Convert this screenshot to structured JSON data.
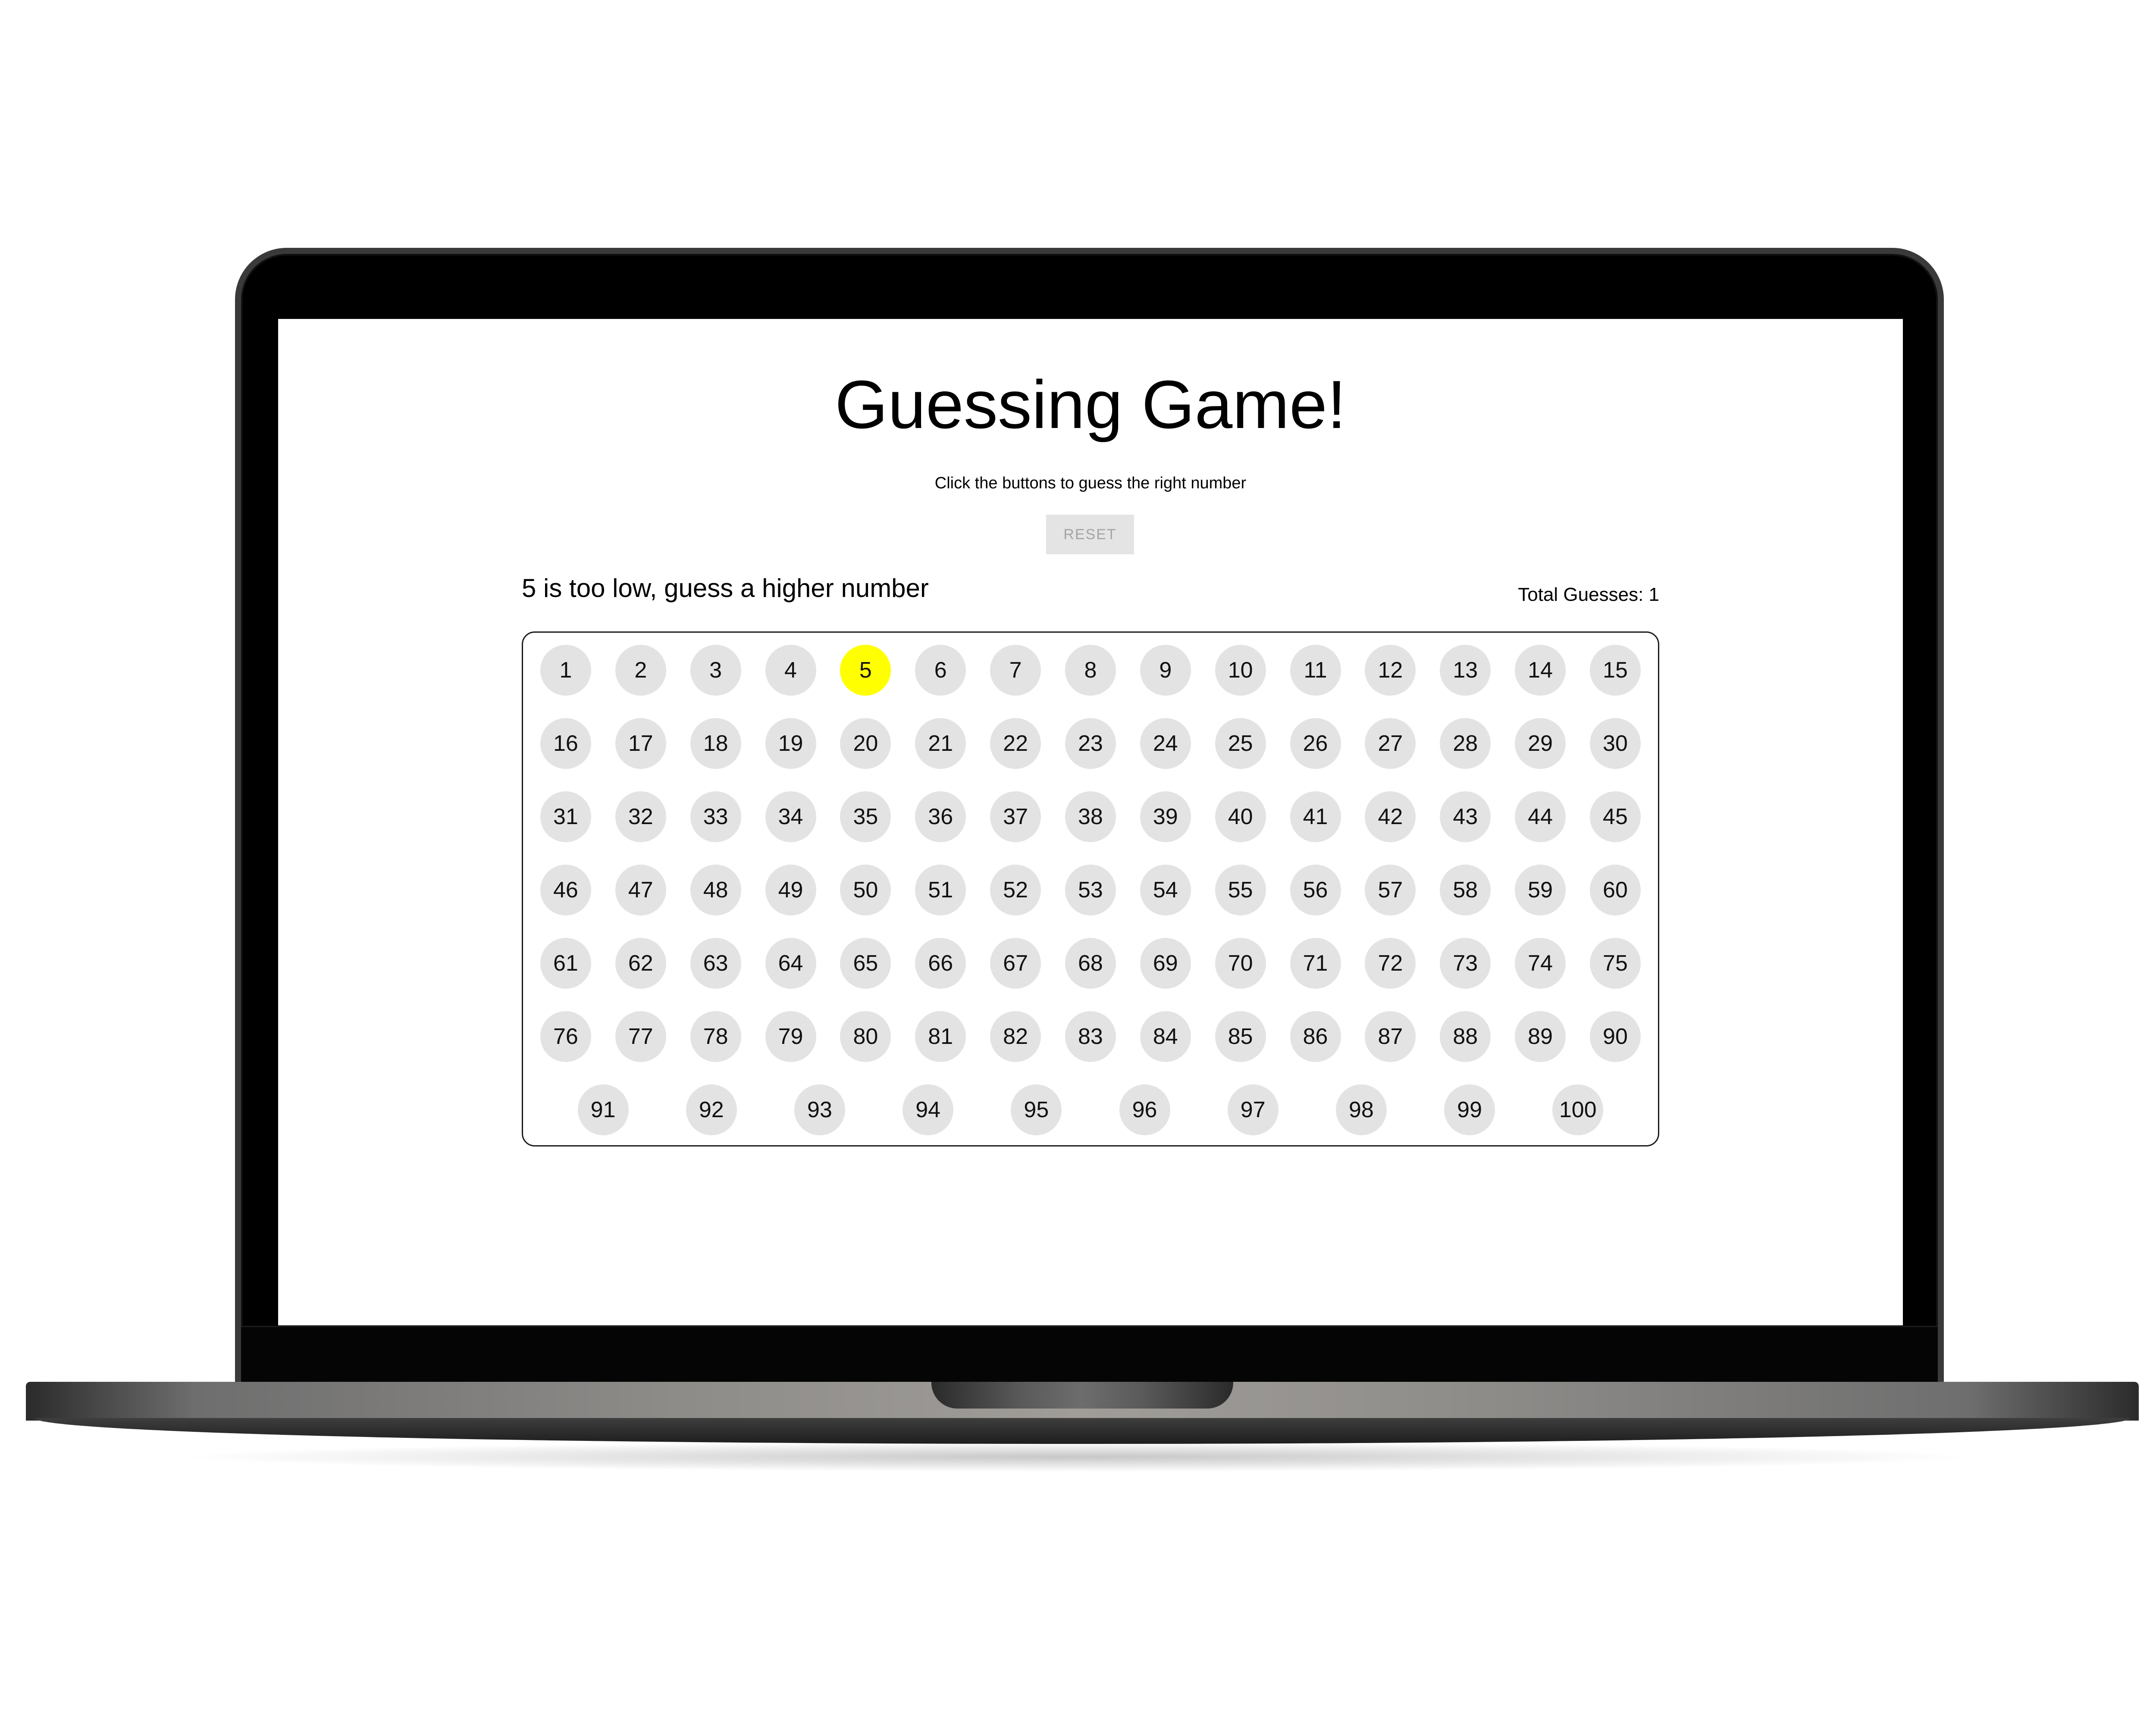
{
  "app": {
    "title": "Guessing Game!",
    "subtitle": "Click the buttons to guess the right number",
    "reset_label": "RESET",
    "message": "5 is too low, guess a higher number",
    "total_guesses_label": "Total Guesses: 1",
    "selected_number": 5,
    "highlight_color": "#ffff00",
    "button_color": "#e3e3e3",
    "numbers": [
      1,
      2,
      3,
      4,
      5,
      6,
      7,
      8,
      9,
      10,
      11,
      12,
      13,
      14,
      15,
      16,
      17,
      18,
      19,
      20,
      21,
      22,
      23,
      24,
      25,
      26,
      27,
      28,
      29,
      30,
      31,
      32,
      33,
      34,
      35,
      36,
      37,
      38,
      39,
      40,
      41,
      42,
      43,
      44,
      45,
      46,
      47,
      48,
      49,
      50,
      51,
      52,
      53,
      54,
      55,
      56,
      57,
      58,
      59,
      60,
      61,
      62,
      63,
      64,
      65,
      66,
      67,
      68,
      69,
      70,
      71,
      72,
      73,
      74,
      75,
      76,
      77,
      78,
      79,
      80,
      81,
      82,
      83,
      84,
      85,
      86,
      87,
      88,
      89,
      90,
      91,
      92,
      93,
      94,
      95,
      96,
      97,
      98,
      99,
      100
    ]
  }
}
